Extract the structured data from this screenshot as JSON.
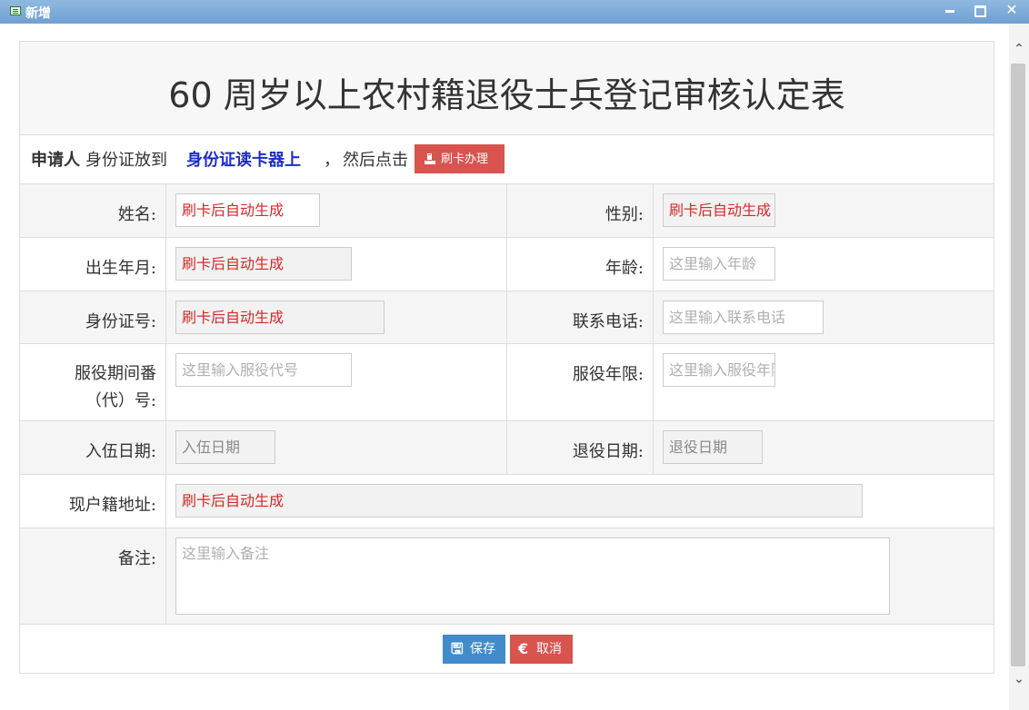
{
  "window": {
    "title": "新增",
    "icon": "form-window-icon",
    "controls": [
      "minimize-icon",
      "maximize-icon",
      "close-icon"
    ]
  },
  "form": {
    "title": "60 周岁以上农村籍退役士兵登记审核认定表",
    "tip": {
      "part1": "申请人",
      "part2": "身份证放到",
      "part3": "身份证读卡器上",
      "part4": "，",
      "part5": "然后点击",
      "button": "刷卡办理"
    },
    "fields": {
      "name": {
        "label": "姓名:",
        "value": "刷卡后自动生成"
      },
      "gender": {
        "label": "性别:",
        "value": "刷卡后自动生成"
      },
      "birth": {
        "label": "出生年月:",
        "value": "刷卡后自动生成"
      },
      "age": {
        "label": "年龄:",
        "placeholder": "这里输入年龄"
      },
      "idcard": {
        "label": "身份证号:",
        "value": "刷卡后自动生成"
      },
      "phone": {
        "label": "联系电话:",
        "placeholder": "这里输入联系电话"
      },
      "service_code": {
        "label_line1": "服役期间番",
        "label_line2": "（代）号:",
        "placeholder": "这里输入服役代号"
      },
      "service_years": {
        "label": "服役年限:",
        "placeholder": "这里输入服役年限"
      },
      "enlist_date": {
        "label": "入伍日期:",
        "placeholder": "入伍日期"
      },
      "discharge_date": {
        "label": "退役日期:",
        "placeholder": "退役日期"
      },
      "address": {
        "label": "现户籍地址:",
        "value": "刷卡后自动生成"
      },
      "remark": {
        "label": "备注:",
        "placeholder": "这里输入备注"
      }
    },
    "buttons": {
      "save": "保存",
      "cancel": "取消"
    }
  },
  "colors": {
    "titlebar": "#7aaad6",
    "danger": "#d9534f",
    "primary": "#428bca",
    "autofill_text": "#d62828"
  }
}
